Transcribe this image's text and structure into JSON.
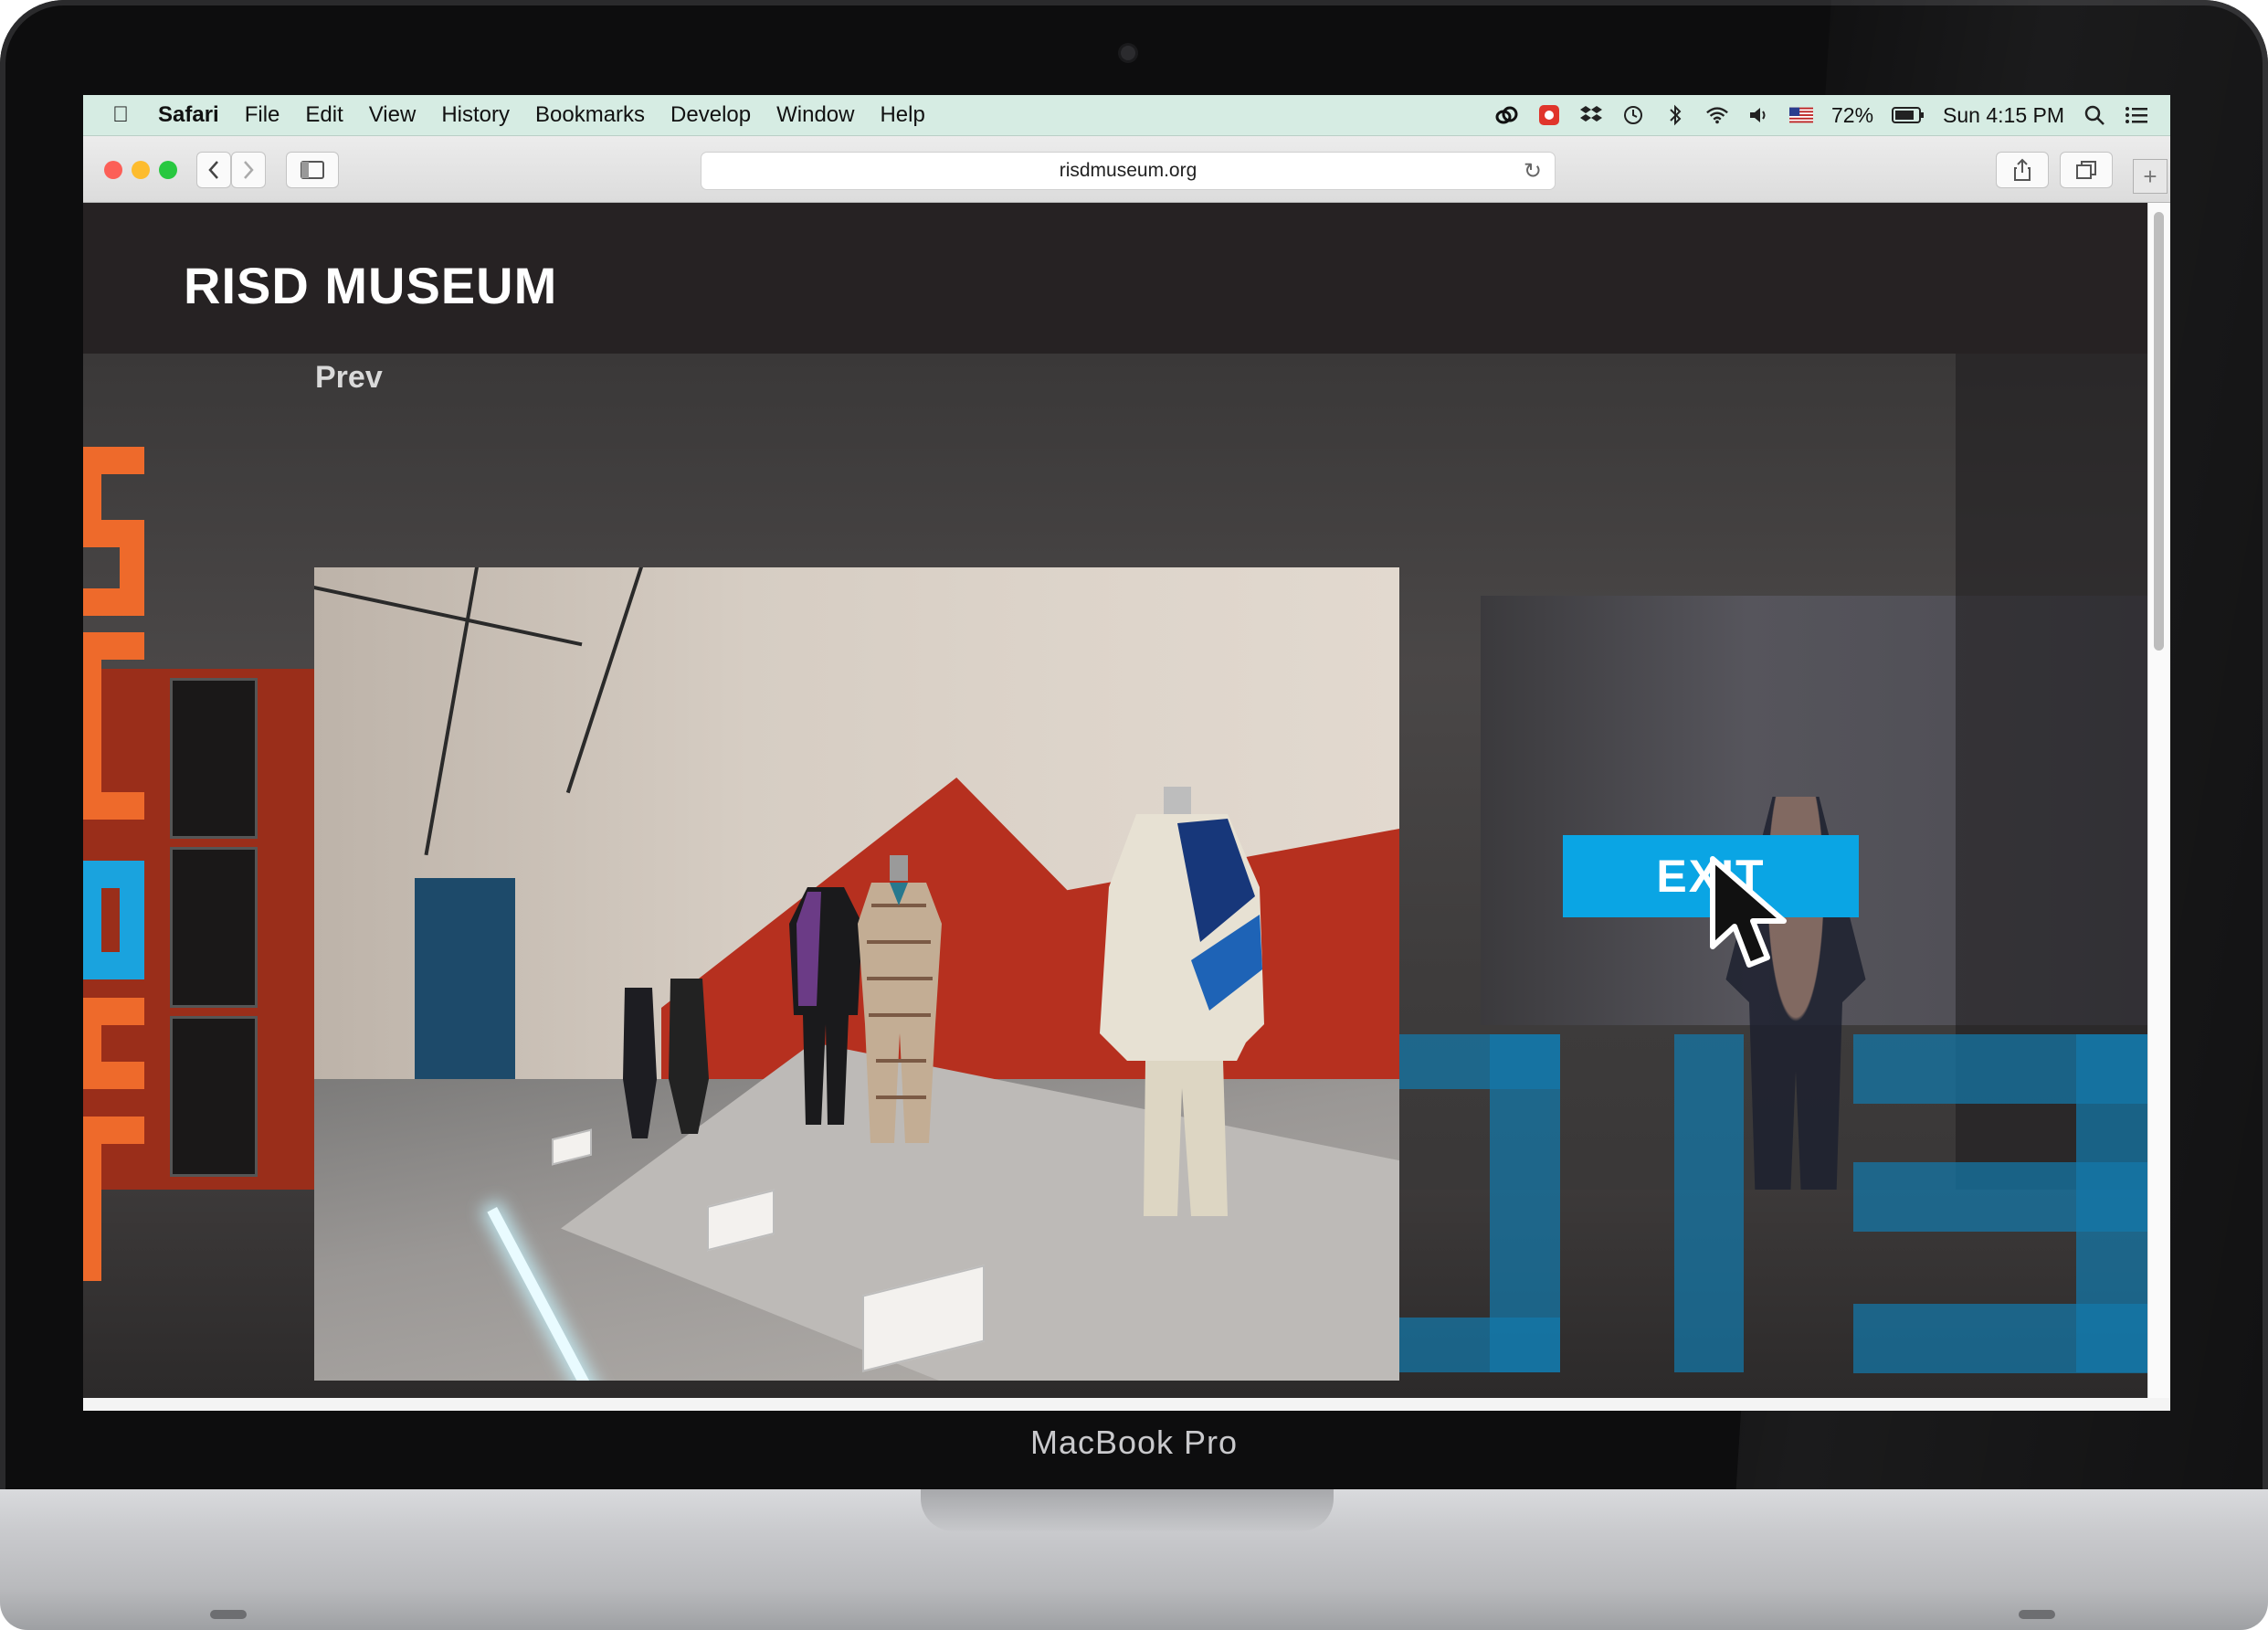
{
  "device": {
    "brand_label": "MacBook Pro"
  },
  "menubar": {
    "app_name": "Safari",
    "items": [
      "File",
      "Edit",
      "View",
      "History",
      "Bookmarks",
      "Develop",
      "Window",
      "Help"
    ],
    "battery_percent": "72%",
    "clock": "Sun 4:15 PM",
    "tray_icons": [
      "creative-cloud-icon",
      "record-icon",
      "dropbox-icon",
      "time-machine-icon",
      "bluetooth-icon",
      "wifi-icon",
      "volume-icon",
      "us-flag-icon",
      "battery-icon",
      "spotlight-search-icon",
      "notification-center-icon"
    ]
  },
  "toolbar": {
    "url": "risdmuseum.org"
  },
  "site": {
    "title": "RISD MUSEUM",
    "prev_label": "Prev",
    "exit_label": "EXIT"
  },
  "colors": {
    "accent_blue": "#0aa5e4",
    "accent_orange": "#ee6a2b",
    "header_dark": "#262223",
    "menubar_tint": "#d6ece3"
  }
}
